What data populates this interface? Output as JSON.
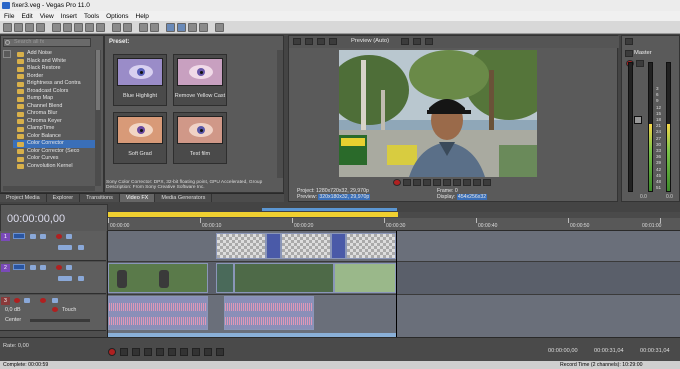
{
  "window": {
    "title": "fixer3.veg - Vegas Pro 11.0"
  },
  "menu": [
    "File",
    "Edit",
    "View",
    "Insert",
    "Tools",
    "Options",
    "Help"
  ],
  "explorer": {
    "search_placeholder": "Search all fx",
    "items": [
      {
        "label": "Add Noise"
      },
      {
        "label": "Black and White"
      },
      {
        "label": "Black Restore"
      },
      {
        "label": "Border"
      },
      {
        "label": "Brightness and Contra"
      },
      {
        "label": "Broadcast Colors"
      },
      {
        "label": "Bump Map"
      },
      {
        "label": "Channel Blend"
      },
      {
        "label": "Chroma Blur"
      },
      {
        "label": "Chroma Keyer"
      },
      {
        "label": "ClampTime"
      },
      {
        "label": "Color Balance"
      },
      {
        "label": "Color Corrector",
        "selected": true
      },
      {
        "label": "Color Corrector (Seco"
      },
      {
        "label": "Color Curves"
      },
      {
        "label": "Convolution Kernel"
      }
    ]
  },
  "presets": {
    "header": "Preset:",
    "items": [
      {
        "label": "Blue Highlight",
        "iris_color": "#5a60b8"
      },
      {
        "label": "Remove Yellow Cast",
        "iris_color": "#6a58a8"
      },
      {
        "label": "Soft Grad",
        "iris_color": "#6a4aa0"
      },
      {
        "label": "Test film",
        "iris_color": "#5a58a8"
      }
    ],
    "description_line1": "Sony Color Corrector: DPX, 32-bit floating point, GPU Accelerated, Group",
    "description_line2": "Description: From Sony Creative Software Inc."
  },
  "tabs": [
    {
      "label": "Project Media",
      "active": false
    },
    {
      "label": "Explorer",
      "active": false
    },
    {
      "label": "Transitions",
      "active": false
    },
    {
      "label": "Video FX",
      "active": true
    },
    {
      "label": "Media Generators",
      "active": false
    }
  ],
  "preview": {
    "mode": "Preview (Auto)",
    "project_label": "Project:",
    "project_value": "1280x720x32, 29,970p",
    "preview_label": "Preview:",
    "preview_value": "320x180x32, 29,970p",
    "frame_label": "Frame:",
    "frame_value": "0",
    "display_label": "Display:",
    "display_value": "454x256x32"
  },
  "master": {
    "title": "Master",
    "scale": [
      "3",
      "6",
      "9",
      "12",
      "15",
      "18",
      "21",
      "24",
      "27",
      "30",
      "33",
      "36",
      "39",
      "42",
      "45",
      "48",
      "51",
      "54",
      "57"
    ],
    "bottom_left": "0.0",
    "bottom_right": "0.0"
  },
  "timeline": {
    "timecode": "00:00:00,00",
    "ruler": [
      "00:00:00",
      "00:00:10",
      "00:00:20",
      "00:00:30",
      "00:00:40",
      "00:00:50",
      "00:01:00"
    ],
    "tracks": [
      {
        "num": "1",
        "type": "video"
      },
      {
        "num": "2",
        "type": "video"
      },
      {
        "num": "3",
        "type": "audio",
        "vol": "0,0 dB",
        "mode": "Touch",
        "pan": "Center"
      }
    ]
  },
  "transport": {
    "rate": "Rate: 0,00",
    "tc1": "00:00:00,00",
    "tc2": "00:00:31,04",
    "tc3": "00:00:31,04"
  },
  "status": {
    "left": "Complete: 00:00:59",
    "right": "Record Time (2 channels): 10:29:00"
  }
}
